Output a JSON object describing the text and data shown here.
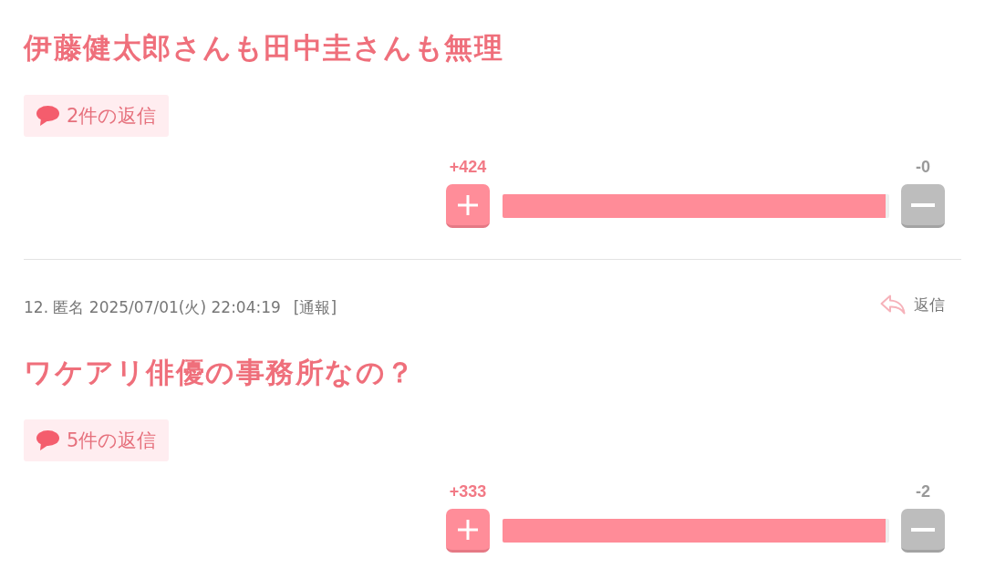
{
  "posts": [
    {
      "title": "伊藤健太郎さんも田中圭さんも無理",
      "replies": "2件の返信",
      "votes": {
        "plus": "+424",
        "minus": "-0",
        "level": 0.99
      }
    },
    {
      "meta": "12. 匿名 2025/07/01(火) 22:04:19",
      "report": "[通報]",
      "reply": "返信",
      "title": "ワケアリ俳優の事務所なの？",
      "replies": "5件の返信",
      "votes": {
        "plus": "+333",
        "minus": "-2",
        "level": 0.99
      }
    }
  ]
}
